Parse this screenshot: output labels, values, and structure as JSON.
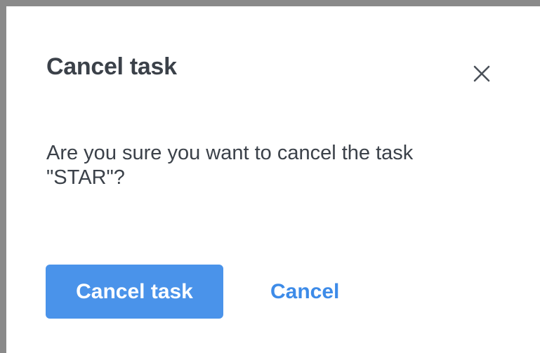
{
  "dialog": {
    "title": "Cancel task",
    "message_line1": "Are you sure you want to cancel the task",
    "message_line2": "\"STAR\"?",
    "close_icon": "close-icon",
    "primary_button_label": "Cancel task",
    "secondary_button_label": "Cancel"
  },
  "colors": {
    "primary": "#4a93ea",
    "link": "#3d8be8",
    "text": "#3b4149",
    "frame_border": "#8a8a8a"
  }
}
